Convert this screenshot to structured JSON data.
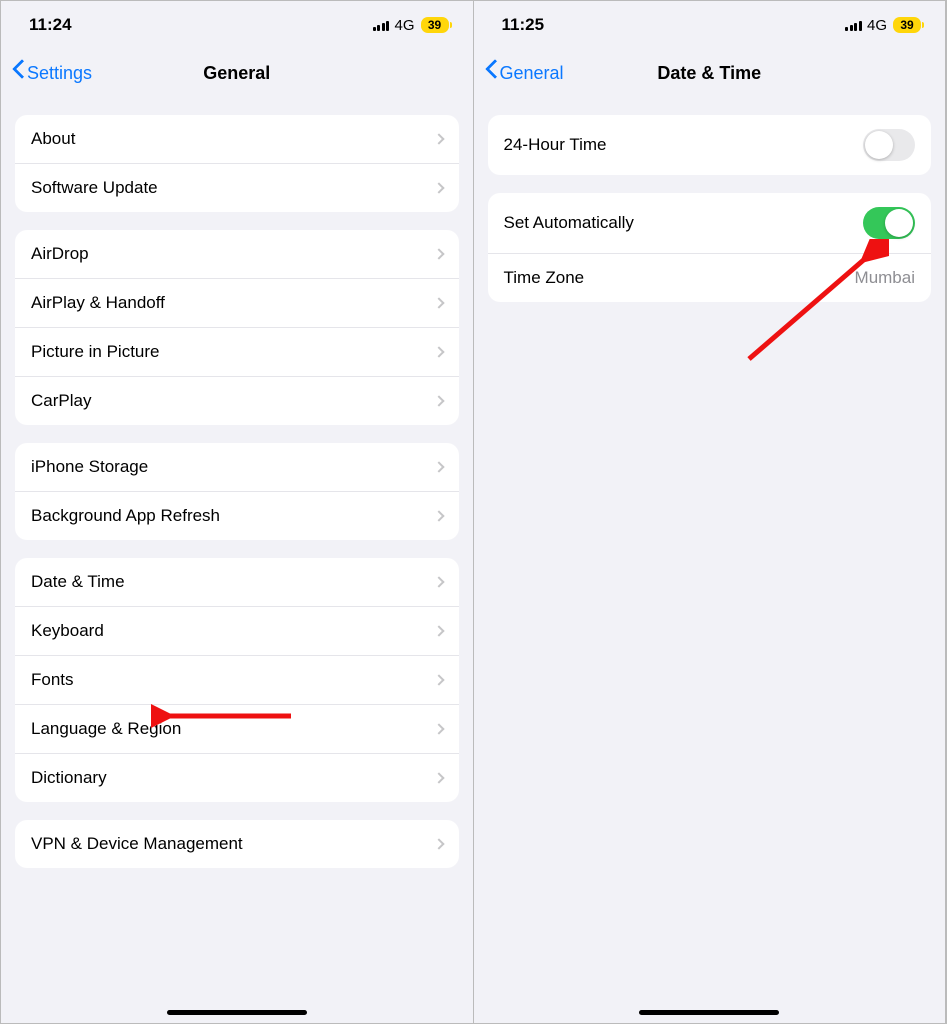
{
  "left": {
    "status": {
      "time": "11:24",
      "network": "4G",
      "battery": "39"
    },
    "nav": {
      "back": "Settings",
      "title": "General"
    },
    "groups": [
      [
        {
          "label": "About"
        },
        {
          "label": "Software Update"
        }
      ],
      [
        {
          "label": "AirDrop"
        },
        {
          "label": "AirPlay & Handoff"
        },
        {
          "label": "Picture in Picture"
        },
        {
          "label": "CarPlay"
        }
      ],
      [
        {
          "label": "iPhone Storage"
        },
        {
          "label": "Background App Refresh"
        }
      ],
      [
        {
          "label": "Date & Time"
        },
        {
          "label": "Keyboard"
        },
        {
          "label": "Fonts"
        },
        {
          "label": "Language & Region"
        },
        {
          "label": "Dictionary"
        }
      ],
      [
        {
          "label": "VPN & Device Management"
        }
      ]
    ]
  },
  "right": {
    "status": {
      "time": "11:25",
      "network": "4G",
      "battery": "39"
    },
    "nav": {
      "back": "General",
      "title": "Date & Time"
    },
    "rows": {
      "twentyFourHour": {
        "label": "24-Hour Time",
        "on": false
      },
      "setAuto": {
        "label": "Set Automatically",
        "on": true
      },
      "timeZone": {
        "label": "Time Zone",
        "value": "Mumbai"
      }
    }
  }
}
